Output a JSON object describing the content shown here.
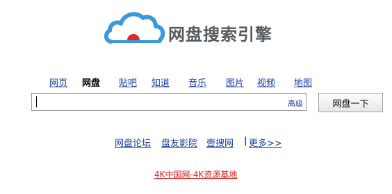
{
  "brand": {
    "title": "网盘搜索引擎",
    "colors": {
      "cloud": "#3a9ad9",
      "sun": "#e0282a",
      "text": "#555a5f",
      "link": "#1a3ea6",
      "promo": "#e02020"
    }
  },
  "nav": {
    "items": [
      {
        "label": "网页",
        "active": false
      },
      {
        "label": "网盘",
        "active": true
      },
      {
        "label": "贴吧",
        "active": false
      },
      {
        "label": "知道",
        "active": false
      },
      {
        "label": "音乐",
        "active": false
      },
      {
        "label": "图片",
        "active": false
      },
      {
        "label": "视频",
        "active": false
      },
      {
        "label": "地图",
        "active": false
      }
    ]
  },
  "search": {
    "value": "",
    "placeholder": "",
    "advanced_label": "高级",
    "button_label": "网盘一下"
  },
  "links": {
    "items": [
      "网盘论坛",
      "盘友影院",
      "壹搜网"
    ],
    "separator": "|",
    "more_label": "更多>>"
  },
  "promo": {
    "label": "4K中国网-4K资源基地"
  }
}
